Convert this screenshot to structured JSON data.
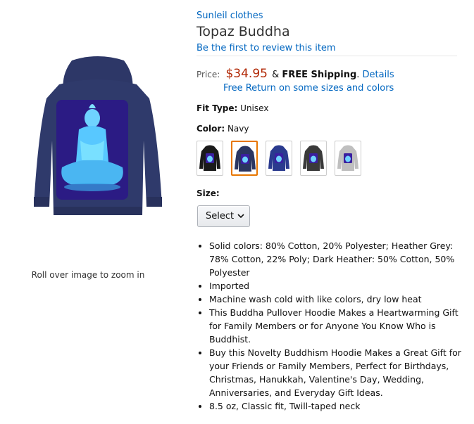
{
  "product": {
    "brand": "Sunleil clothes",
    "title": "Topaz Buddha",
    "review_link": "Be the first to review this item"
  },
  "price": {
    "label": "Price:",
    "amount": "$34.95",
    "connector": "&",
    "free_shipping": "FREE Shipping",
    "details_link": "Details",
    "return_link": "Free Return on some sizes and colors"
  },
  "fit": {
    "label": "Fit Type:",
    "value": "Unisex"
  },
  "color": {
    "label": "Color:",
    "value": "Navy",
    "options": [
      {
        "name": "Black",
        "hex": "#1a1a1a"
      },
      {
        "name": "Navy",
        "hex": "#2b3560"
      },
      {
        "name": "Royal Blue",
        "hex": "#2a3a8e"
      },
      {
        "name": "Dark Heather",
        "hex": "#3a3a3a"
      },
      {
        "name": "Heather Grey",
        "hex": "#bfbfbf"
      }
    ],
    "selected_index": 1
  },
  "size": {
    "label": "Size:",
    "select_label": "Select"
  },
  "bullets": [
    "Solid colors: 80% Cotton, 20% Polyester; Heather Grey: 78% Cotton, 22% Poly; Dark Heather: 50% Cotton, 50% Polyester",
    "Imported",
    "Machine wash cold with like colors, dry low heat",
    "This Buddha Pullover Hoodie Makes a Heartwarming Gift for Family Members or for Anyone You Know Who is Buddhist.",
    "Buy this Novelty Buddhism Hoodie Makes a Great Gift for your Friends or Family Members, Perfect for Birthdays, Christmas, Hanukkah, Valentine's Day, Wedding, Anniversaries, and Everyday Gift Ideas.",
    "8.5 oz, Classic fit, Twill-taped neck"
  ],
  "image": {
    "zoom_hint": "Roll over image to zoom in"
  }
}
